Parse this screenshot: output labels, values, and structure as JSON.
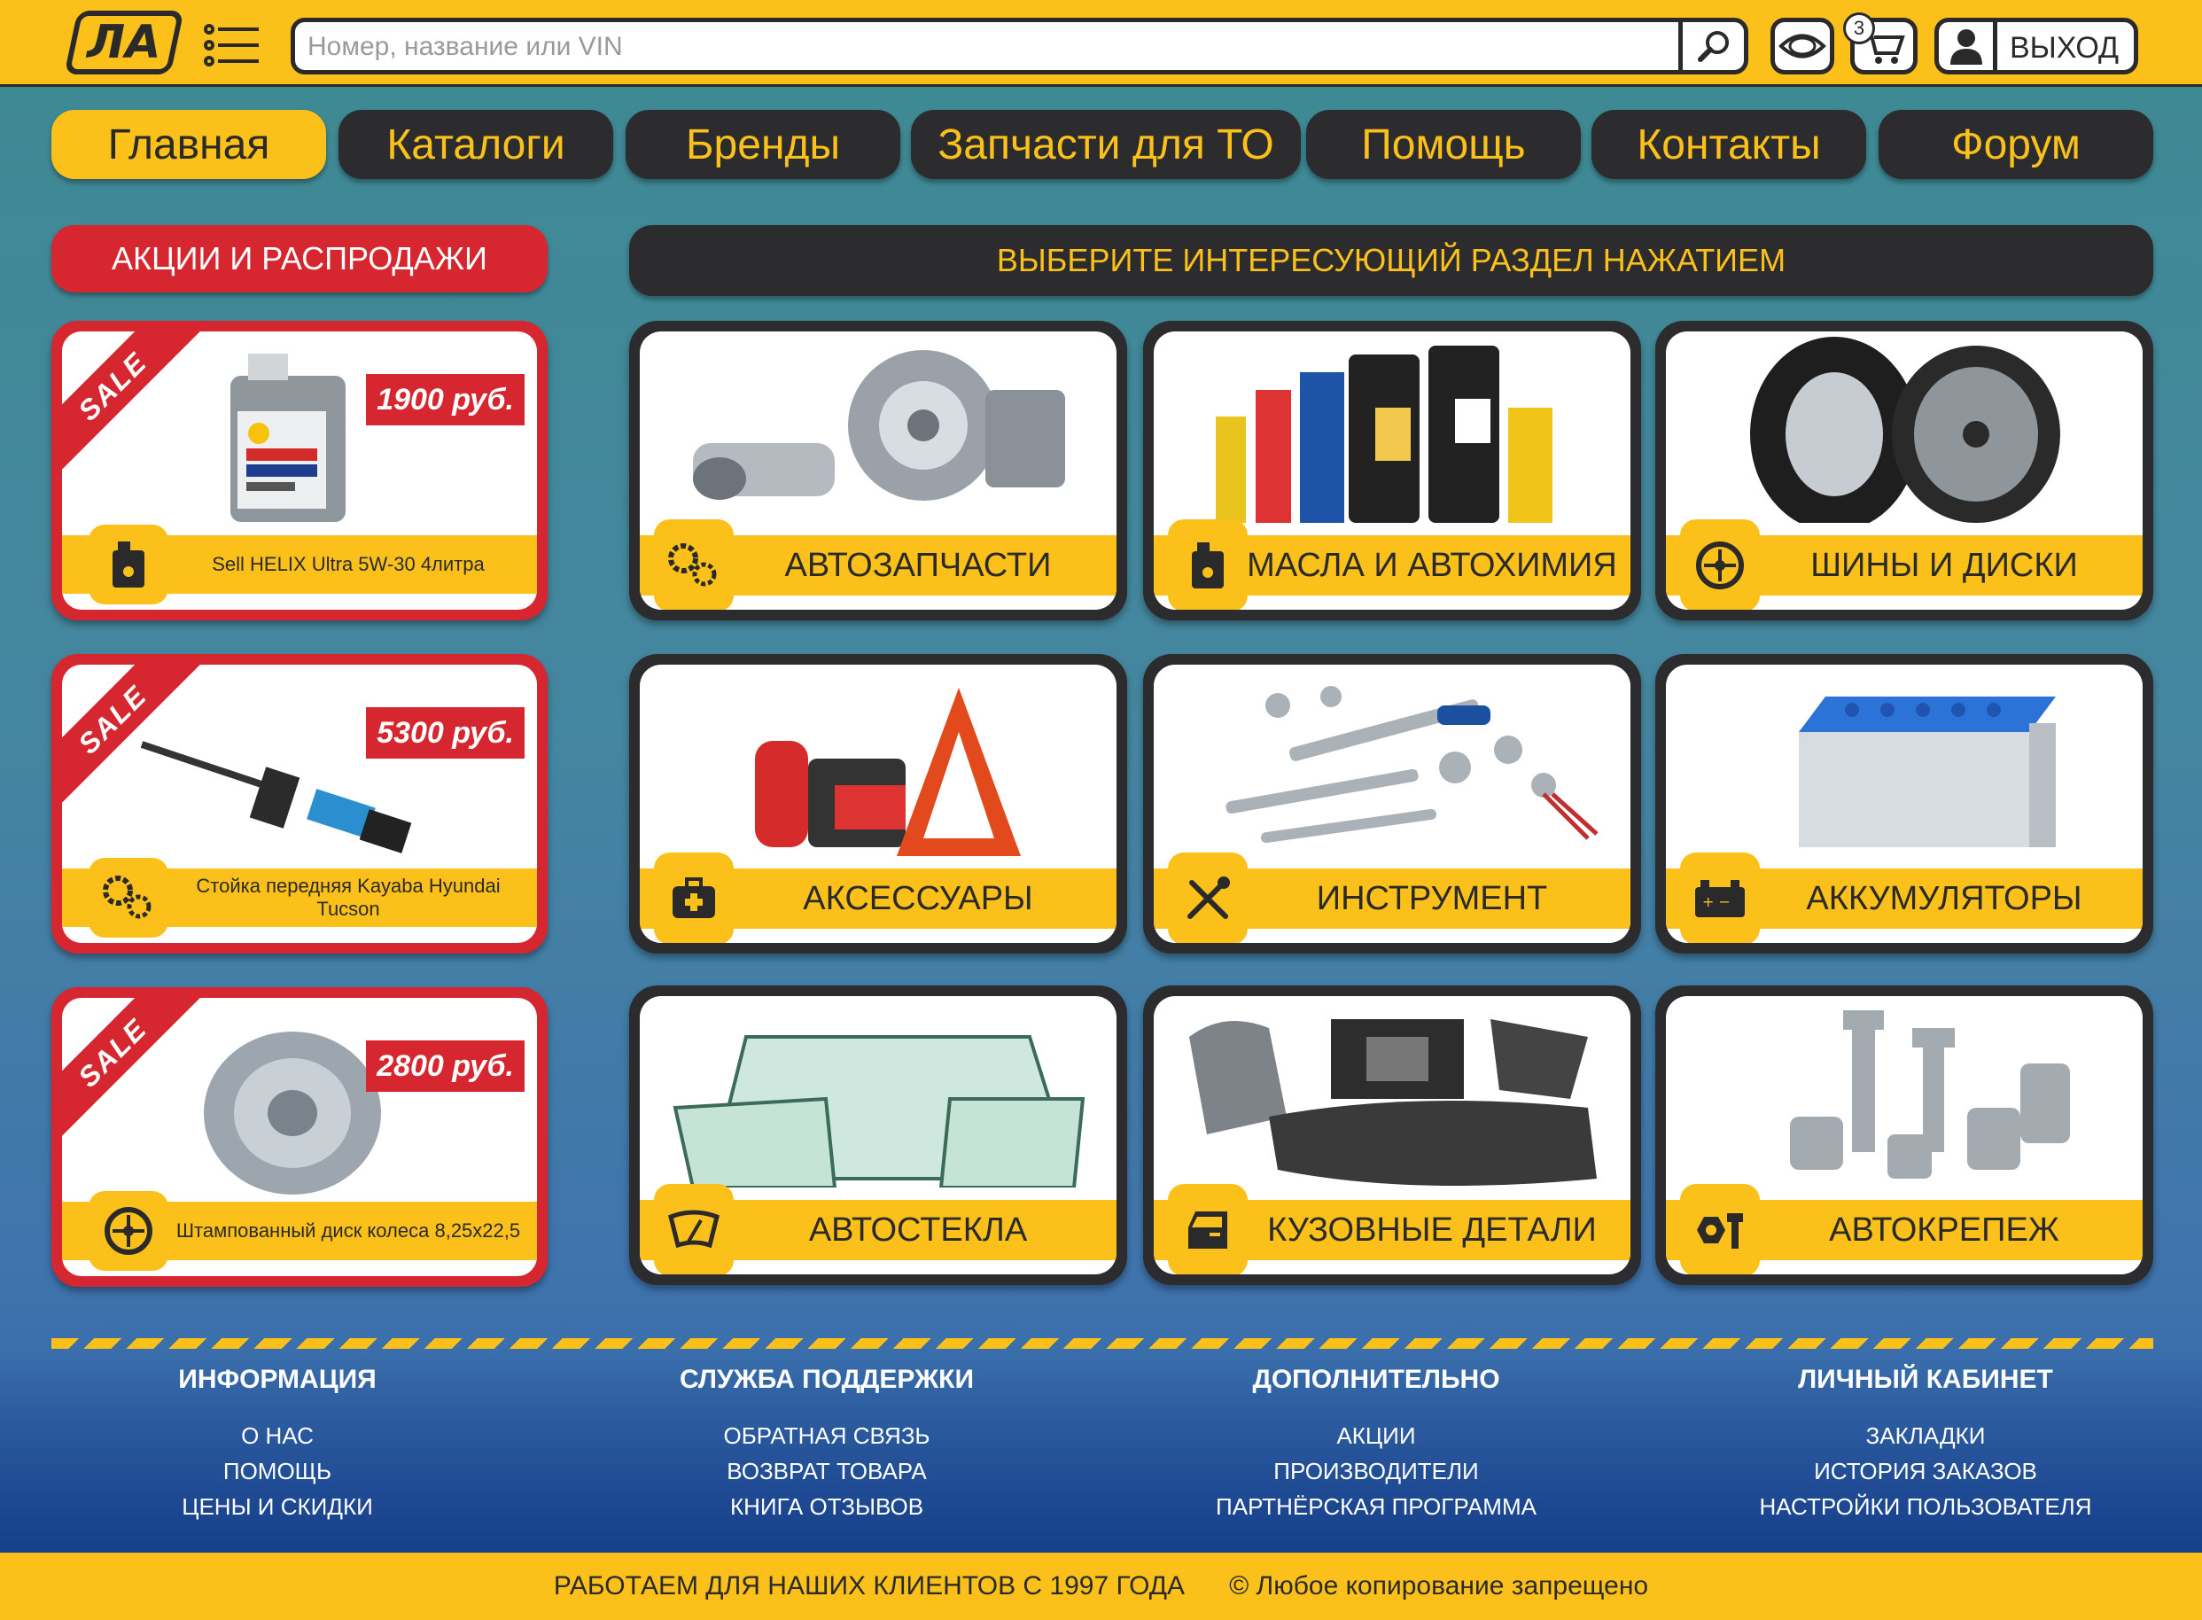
{
  "header": {
    "logo": "ЛА",
    "search_placeholder": "Номер, название или VIN",
    "cart_count": "3",
    "logout": "ВЫХОД"
  },
  "nav": [
    "Главная",
    "Каталоги",
    "Бренды",
    "Запчасти для ТО",
    "Помощь",
    "Контакты",
    "Форум"
  ],
  "promos": {
    "title": "АКЦИИ И РАСПРОДАЖИ",
    "sale_label": "SALE",
    "items": [
      {
        "price": "1900 руб.",
        "name": "Sell HELIX Ultra 5W-30 4литра",
        "icon": "oil-can-icon"
      },
      {
        "price": "5300 руб.",
        "name": "Стойка передняя Kayaba Hyundai Tucson",
        "icon": "gears-icon"
      },
      {
        "price": "2800 руб.",
        "name": "Штампованный диск колеса 8,25x22,5",
        "icon": "wheel-icon"
      }
    ]
  },
  "categories": {
    "title": "ВЫБЕРИТЕ ИНТЕРЕСУЮЩИЙ РАЗДЕЛ НАЖАТИЕМ",
    "items": [
      {
        "label": "АВТОЗАПЧАСТИ",
        "icon": "gears-icon"
      },
      {
        "label": "МАСЛА И АВТОХИМИЯ",
        "icon": "oil-can-icon"
      },
      {
        "label": "ШИНЫ И ДИСКИ",
        "icon": "wheel-icon"
      },
      {
        "label": "АКСЕССУАРЫ",
        "icon": "first-aid-icon"
      },
      {
        "label": "ИНСТРУМЕНТ",
        "icon": "tools-icon"
      },
      {
        "label": "АККУМУЛЯТОРЫ",
        "icon": "battery-icon"
      },
      {
        "label": "АВТОСТЕКЛА",
        "icon": "windshield-icon"
      },
      {
        "label": "КУЗОВНЫЕ ДЕТАЛИ",
        "icon": "car-door-icon"
      },
      {
        "label": "АВТОКРЕПЕЖ",
        "icon": "bolt-nut-icon"
      }
    ]
  },
  "footer": {
    "columns": [
      {
        "title": "ИНФОРМАЦИЯ",
        "links": [
          "О НАС",
          "ПОМОЩЬ",
          "ЦЕНЫ И СКИДКИ"
        ]
      },
      {
        "title": "СЛУЖБА ПОДДЕРЖКИ",
        "links": [
          "ОБРАТНАЯ СВЯЗЬ",
          "ВОЗВРАТ ТОВАРА",
          "КНИГА ОТЗЫВОВ"
        ]
      },
      {
        "title": "ДОПОЛНИТЕЛЬНО",
        "links": [
          "АКЦИИ",
          "ПРОИЗВОДИТЕЛИ",
          "ПАРТНЁРСКАЯ ПРОГРАММА"
        ]
      },
      {
        "title": "ЛИЧНЫЙ КАБИНЕТ",
        "links": [
          "ЗАКЛАДКИ",
          "ИСТОРИЯ ЗАКАЗОВ",
          "НАСТРОЙКИ ПОЛЬЗОВАТЕЛЯ"
        ]
      }
    ],
    "slogan": "РАБОТАЕМ ДЛЯ НАШИХ КЛИЕНТОВ С 1997 ГОДА",
    "copyright": "©  Любое копирование запрещено"
  },
  "colors": {
    "accent": "#fbc11a",
    "dark": "#2c2c2e",
    "sale": "#d6262f"
  }
}
